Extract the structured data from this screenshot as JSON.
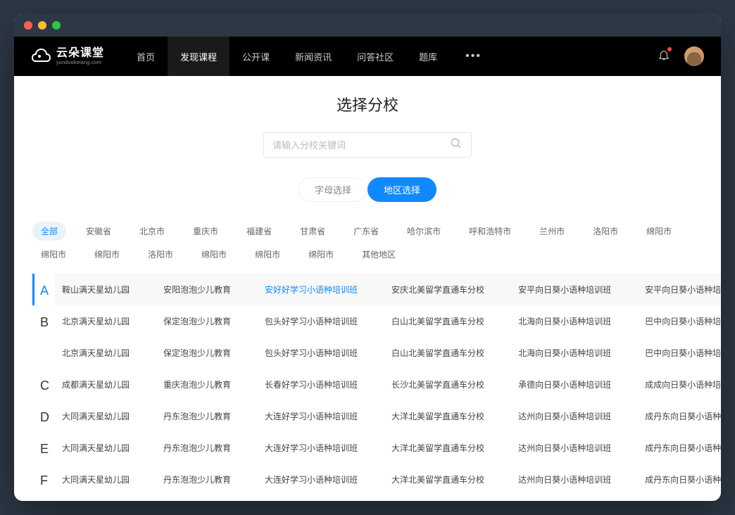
{
  "logo": {
    "main": "云朵课堂",
    "sub": "yunduoketang.com"
  },
  "nav": {
    "items": [
      "首页",
      "发现课程",
      "公开课",
      "新闻资讯",
      "问答社区",
      "题库"
    ],
    "activeIndex": 1
  },
  "page": {
    "title": "选择分校",
    "searchPlaceholder": "请输入分校关键词"
  },
  "toggle": {
    "alpha": "字母选择",
    "region": "地区选择"
  },
  "regions": [
    "全部",
    "安徽省",
    "北京市",
    "重庆市",
    "福建省",
    "甘肃省",
    "广东省",
    "哈尔滨市",
    "呼和浩特市",
    "兰州市",
    "洛阳市",
    "绵阳市",
    "绵阳市",
    "绵阳市",
    "洛阳市",
    "绵阳市",
    "绵阳市",
    "绵阳市",
    "其他地区"
  ],
  "regionActiveIndex": 0,
  "sections": [
    {
      "letter": "A",
      "highlighted": true,
      "rows": [
        [
          {
            "text": "鞍山满天星幼儿园"
          },
          {
            "text": "安阳泡泡少儿教育"
          },
          {
            "text": "安好好学习小语种培训班",
            "highlighted": true
          },
          {
            "text": "安庆北美留学直通车分校"
          },
          {
            "text": "安平向日葵小语种培训班"
          },
          {
            "text": "安平向日葵小语种培训班"
          }
        ]
      ]
    },
    {
      "letter": "B",
      "rows": [
        [
          {
            "text": "北京满天星幼儿园"
          },
          {
            "text": "保定泡泡少儿教育"
          },
          {
            "text": "包头好学习小语种培训班"
          },
          {
            "text": "白山北美留学直通车分校"
          },
          {
            "text": "北海向日葵小语种培训班"
          },
          {
            "text": "巴中向日葵小语种培训班"
          }
        ],
        [
          {
            "text": "北京满天星幼儿园"
          },
          {
            "text": "保定泡泡少儿教育"
          },
          {
            "text": "包头好学习小语种培训班"
          },
          {
            "text": "白山北美留学直通车分校"
          },
          {
            "text": "北海向日葵小语种培训班"
          },
          {
            "text": "巴中向日葵小语种培训班"
          }
        ]
      ]
    },
    {
      "letter": "C",
      "rows": [
        [
          {
            "text": "成都满天星幼儿园"
          },
          {
            "text": "重庆泡泡少儿教育"
          },
          {
            "text": "长春好学习小语种培训班"
          },
          {
            "text": "长沙北美留学直通车分校"
          },
          {
            "text": "承德向日葵小语种培训班"
          },
          {
            "text": "成成向日葵小语种培训班"
          }
        ]
      ]
    },
    {
      "letter": "D",
      "rows": [
        [
          {
            "text": "大同满天星幼儿园"
          },
          {
            "text": "丹东泡泡少儿教育"
          },
          {
            "text": "大连好学习小语种培训班"
          },
          {
            "text": "大洋北美留学直通车分校"
          },
          {
            "text": "达州向日葵小语种培训班"
          },
          {
            "text": "成丹东向日葵小语种培训班"
          }
        ]
      ]
    },
    {
      "letter": "E",
      "rows": [
        [
          {
            "text": "大同满天星幼儿园"
          },
          {
            "text": "丹东泡泡少儿教育"
          },
          {
            "text": "大连好学习小语种培训班"
          },
          {
            "text": "大洋北美留学直通车分校"
          },
          {
            "text": "达州向日葵小语种培训班"
          },
          {
            "text": "成丹东向日葵小语种培训班"
          }
        ]
      ]
    },
    {
      "letter": "F",
      "rows": [
        [
          {
            "text": "大同满天星幼儿园"
          },
          {
            "text": "丹东泡泡少儿教育"
          },
          {
            "text": "大连好学习小语种培训班"
          },
          {
            "text": "大洋北美留学直通车分校"
          },
          {
            "text": "达州向日葵小语种培训班"
          },
          {
            "text": "成丹东向日葵小语种培训班"
          }
        ]
      ]
    }
  ]
}
